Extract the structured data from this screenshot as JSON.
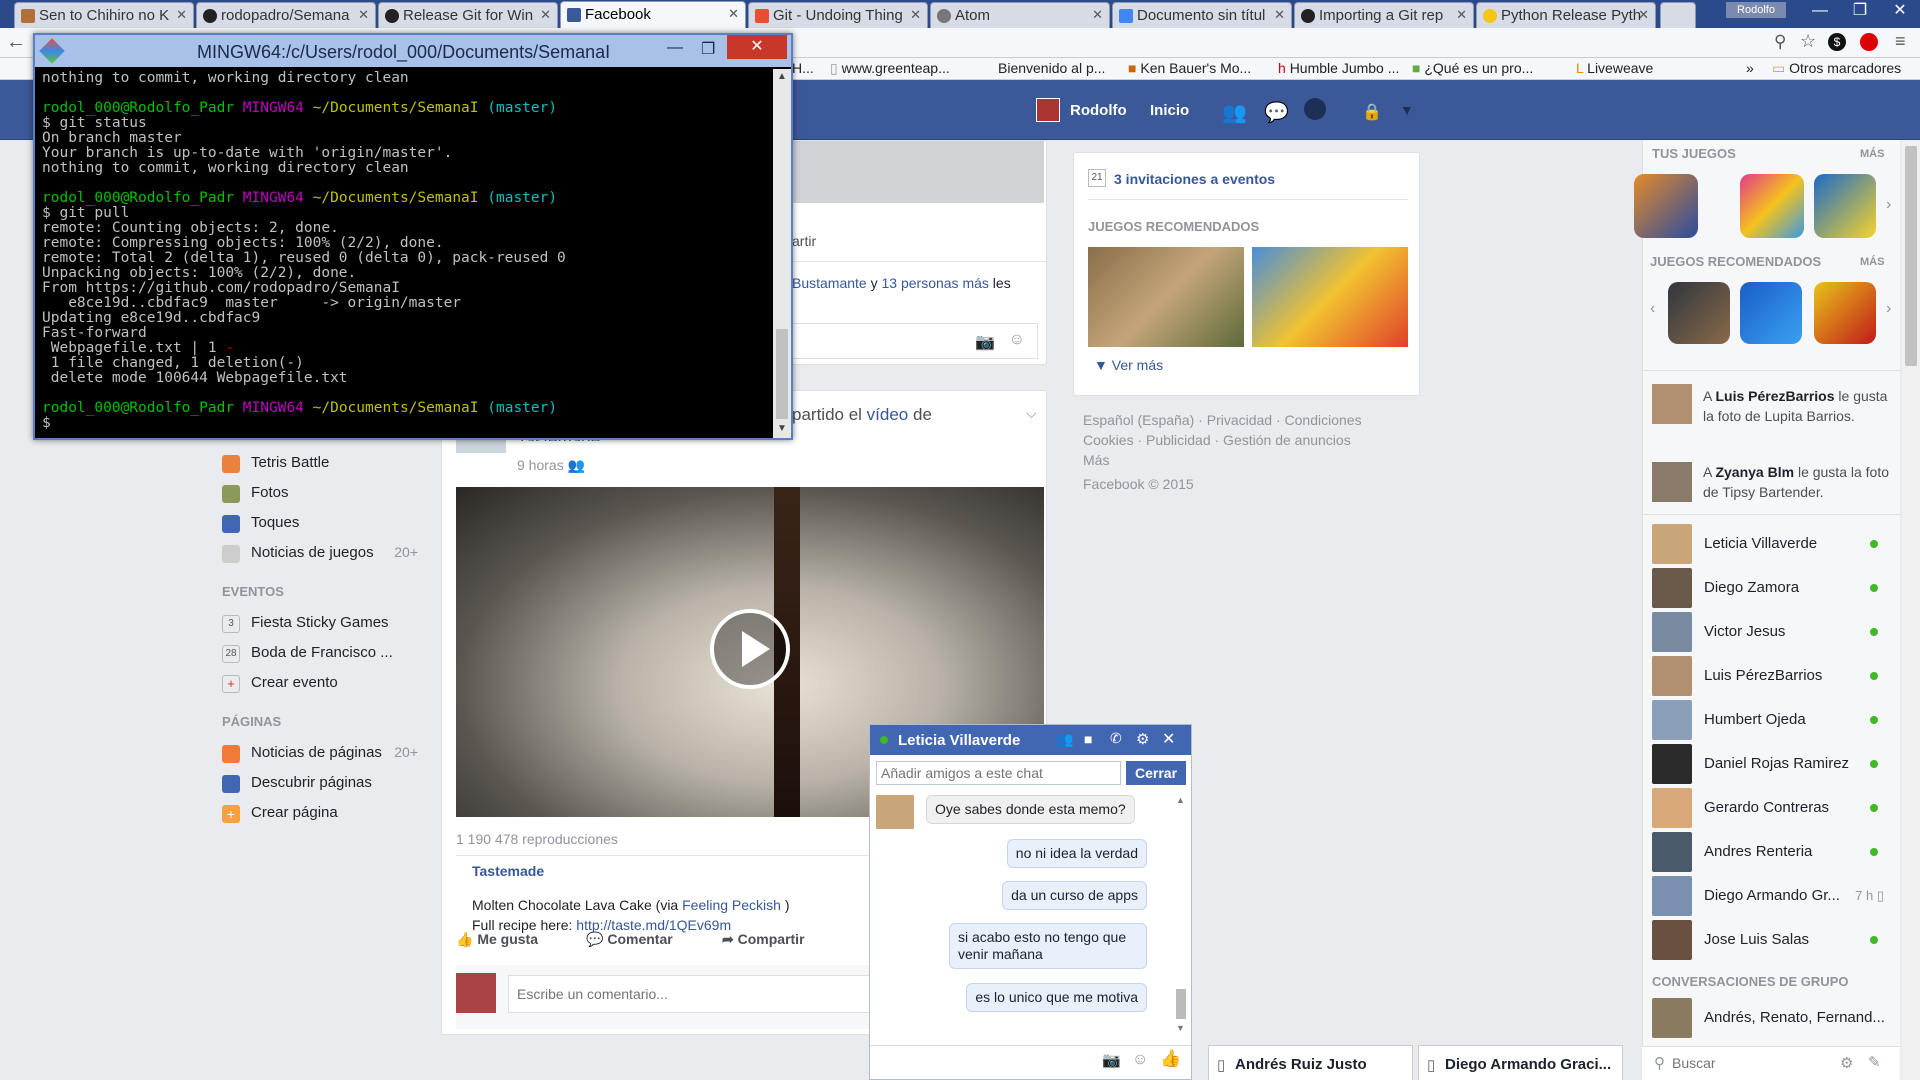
{
  "browser": {
    "tabs": [
      {
        "label": "Sen to Chihiro no K"
      },
      {
        "label": "rodopadro/Semana"
      },
      {
        "label": "Release Git for Win"
      },
      {
        "label": "Facebook",
        "active": true
      },
      {
        "label": "Git - Undoing Thing"
      },
      {
        "label": "Atom"
      },
      {
        "label": "Documento sin títul"
      },
      {
        "label": "Importing a Git rep"
      },
      {
        "label": "Python Release Pyth"
      }
    ],
    "user_badge": "Rodolfo",
    "bookmarks": [
      "H...",
      "www.greenteap...",
      "Bienvenido al p...",
      "Ken Bauer's Mo...",
      "Humble Jumbo ...",
      "¿Qué es un pro...",
      "Liveweave",
      "»",
      "Otros marcadores"
    ]
  },
  "terminal": {
    "title": "MINGW64:/c/Users/rodol_000/Documents/SemanaI",
    "prompt_user": "rodol_000@Rodolfo_Padr",
    "prompt_env": "MINGW64",
    "prompt_path": "~/Documents/SemanaI",
    "prompt_branch": "(master)",
    "line01": "nothing to commit, working directory clean",
    "line03": "$ git status",
    "line04": "On branch master",
    "line05": "Your branch is up-to-date with 'origin/master'.",
    "line06": "nothing to commit, working directory clean",
    "line09": "$ git pull",
    "line10": "remote: Counting objects: 2, done.",
    "line11": "remote: Compressing objects: 100% (2/2), done.",
    "line12": "remote: Total 2 (delta 1), reused 0 (delta 0), pack-reused 0",
    "line13": "Unpacking objects: 100% (2/2), done.",
    "line14": "From https://github.com/rodopadro/SemanaI",
    "line15": "   e8ce19d..cbdfac9  master     -> origin/master",
    "line16": "Updating e8ce19d..cbdfac9",
    "line17": "Fast-forward",
    "line18a": " Webpagefile.txt | 1 ",
    "line18b": "-",
    "line19": " 1 file changed, 1 deletion(-)",
    "line20": " delete mode 100644 Webpagefile.txt",
    "line23": "$"
  },
  "facebook": {
    "header": {
      "profile": "Rodolfo",
      "home": "Inicio"
    },
    "left_nav": {
      "apps": [
        {
          "label": "Tetris Battle"
        },
        {
          "label": "Fotos"
        },
        {
          "label": "Toques"
        },
        {
          "label": "Noticias de juegos",
          "count": "20+"
        }
      ],
      "events_title": "EVENTOS",
      "events": [
        {
          "label": "Fiesta Sticky Games",
          "day": "3"
        },
        {
          "label": "Boda de Francisco ...",
          "day": "28"
        },
        {
          "label": "Crear evento"
        }
      ],
      "pages_title": "PÁGINAS",
      "pages": [
        {
          "label": "Noticias de páginas",
          "count": "20+"
        },
        {
          "label": "Descubrir páginas"
        },
        {
          "label": "Crear página"
        }
      ]
    },
    "feed": {
      "share_partial": "artir",
      "likes_text_a": "Bustamante",
      "likes_text_b": " y ",
      "likes_text_c": "13 personas más",
      "likes_text_d": " les",
      "shared_partial": "partido el",
      "shared_video": "vídeo",
      "shared_de": " de",
      "shared_source_partial": "Tastemade.",
      "time": "9 horas",
      "views": "1 190 478 reproducciones",
      "page_name": "Tastemade",
      "desc_a": "Molten Chocolate Lava Cake (via ",
      "desc_link": "Feeling Peckish",
      "desc_b": " )",
      "recipe_a": "Full recipe here: ",
      "recipe_link": "http://taste.md/1QEv69m",
      "actions": [
        "Me gusta",
        "Comentar",
        "Compartir"
      ],
      "comment_placeholder": "Escribe un comentario..."
    },
    "right_col": {
      "invites": "3 invitaciones a eventos",
      "invites_day": "21",
      "rec_games_title": "JUEGOS RECOMENDADOS",
      "see_more": "Ver más",
      "footer_line1": "Español (España) · Privacidad · Condiciones",
      "footer_line2": "Cookies · Publicidad · Gestión de anuncios",
      "footer_line3": "Más",
      "copyright": "Facebook © 2015"
    },
    "sidebar": {
      "your_games": "TUS JUEGOS",
      "more": "MÁS",
      "rec_games": "JUEGOS RECOMENDADOS",
      "more2": "MÁS",
      "ticker": [
        {
          "name": "Luis PérezBarrios",
          "pre": "A ",
          "post": " le gusta la foto de Lupita Barrios."
        },
        {
          "name": "Zyanya Blm",
          "pre": "A ",
          "post": " le gusta la foto de Tipsy Bartender."
        }
      ],
      "friends": [
        {
          "name": "Leticia Villaverde",
          "online": true
        },
        {
          "name": "Diego Zamora",
          "online": true
        },
        {
          "name": "Victor Jesus",
          "online": true
        },
        {
          "name": "Luis PérezBarrios",
          "online": true
        },
        {
          "name": "Humbert Ojeda",
          "online": true
        },
        {
          "name": "Daniel Rojas Ramirez",
          "online": true
        },
        {
          "name": "Gerardo Contreras",
          "online": true
        },
        {
          "name": "Andres Renteria",
          "online": true
        },
        {
          "name": "Diego Armando Gr...",
          "online": false,
          "idle": "7 h"
        },
        {
          "name": "Jose Luis Salas",
          "online": true
        }
      ],
      "group_title": "CONVERSACIONES DE GRUPO",
      "group_name": "Andrés, Renato, Fernand...",
      "search_placeholder": "Buscar"
    },
    "chat": {
      "name": "Leticia Villaverde",
      "add_placeholder": "Añadir amigos a este chat",
      "close_label": "Cerrar",
      "messages": [
        {
          "text": "Oye sabes donde esta memo?",
          "me": false
        },
        {
          "text": "no ni idea la verdad",
          "me": true
        },
        {
          "text": "da un curso de apps",
          "me": true
        },
        {
          "text": "si acabo esto no tengo que venir mañana",
          "me": true
        },
        {
          "text": "es lo unico que me motiva",
          "me": true
        }
      ]
    },
    "dock": [
      "Andrés Ruiz Justo",
      "Diego Armando Graci..."
    ]
  }
}
